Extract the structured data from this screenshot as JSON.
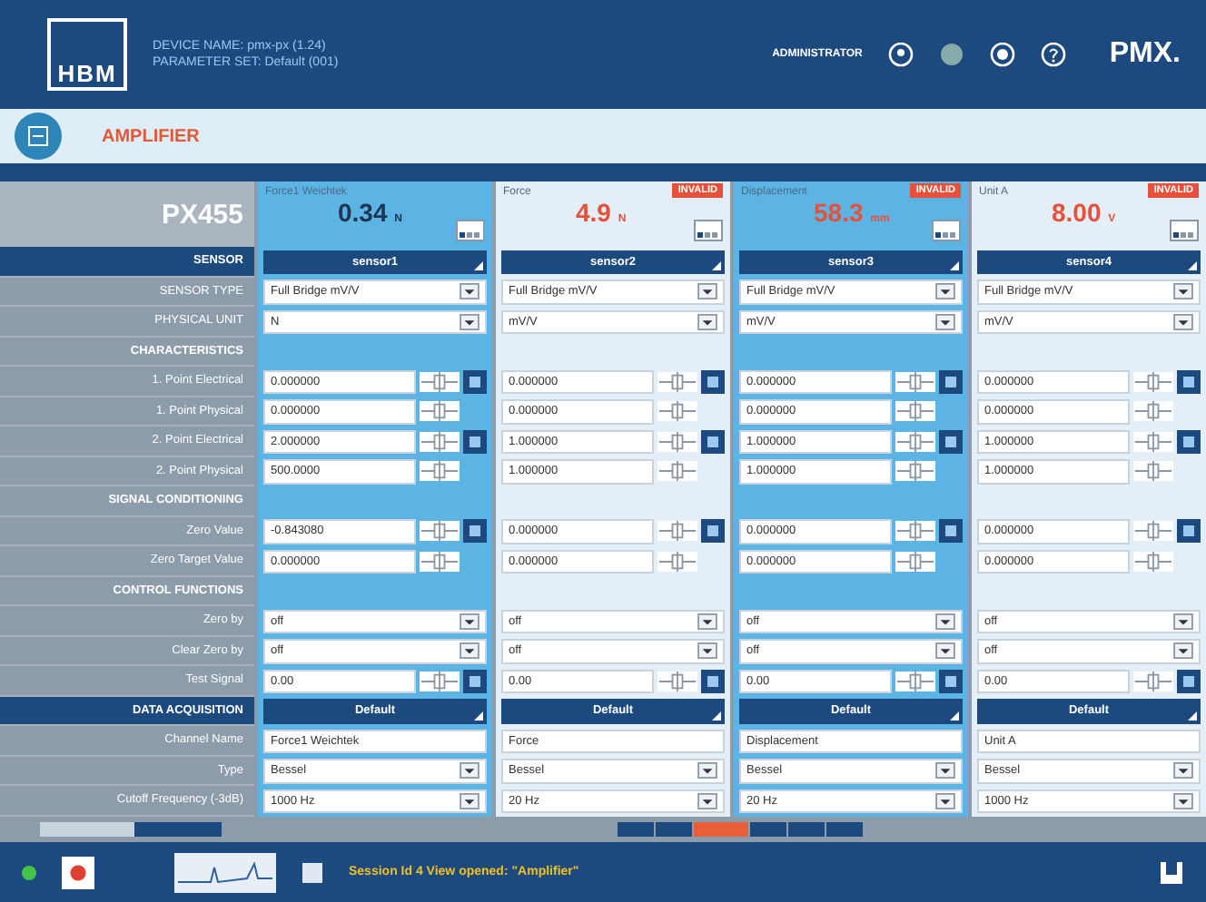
{
  "header": {
    "logo": "HBM",
    "device_name": "DEVICE NAME: pmx-px (1.24)",
    "parameter_set": "PARAMETER SET: Default (001)",
    "user": "ADMINISTRATOR",
    "brand": "PMX."
  },
  "page": {
    "title": "AMPLIFIER"
  },
  "module": "PX455",
  "channels": [
    {
      "name": "Force1 Weichtek",
      "value": "0.34",
      "unit": "N",
      "selected": true
    },
    {
      "name": "Force",
      "value": "4.9",
      "unit": "N",
      "badge": "INVALID",
      "selected": false
    },
    {
      "name": "Displacement",
      "value": "58.3",
      "unit": "mm",
      "badge": "INVALID",
      "selected": true
    },
    {
      "name": "Unit A",
      "value": "8.00",
      "unit": "V",
      "badge": "INVALID",
      "selected": false
    }
  ],
  "rows": [
    {
      "label": "SENSOR",
      "kind": "section",
      "values": [
        "sensor1",
        "sensor2",
        "sensor3",
        "sensor4"
      ]
    },
    {
      "label": "SENSOR TYPE",
      "kind": "select",
      "values": [
        "Full Bridge mV/V",
        "Full Bridge mV/V",
        "Full Bridge mV/V",
        "Full Bridge mV/V"
      ]
    },
    {
      "label": "PHYSICAL UNIT",
      "kind": "select",
      "values": [
        "N",
        "mV/V",
        "mV/V",
        "mV/V"
      ]
    },
    {
      "label": "CHARACTERISTICS",
      "kind": "group"
    },
    {
      "label": "1. Point Electrical",
      "kind": "number",
      "button": true,
      "values": [
        "0.000000",
        "0.000000",
        "0.000000",
        "0.000000"
      ]
    },
    {
      "label": "1. Point Physical",
      "kind": "number",
      "button": false,
      "values": [
        "0.000000",
        "0.000000",
        "0.000000",
        "0.000000"
      ]
    },
    {
      "label": "2. Point Electrical",
      "kind": "number",
      "button": true,
      "values": [
        "2.000000",
        "1.000000",
        "1.000000",
        "1.000000"
      ]
    },
    {
      "label": "2. Point Physical",
      "kind": "number",
      "button": false,
      "values": [
        "500.0000",
        "1.000000",
        "1.000000",
        "1.000000"
      ]
    },
    {
      "label": "SIGNAL CONDITIONING",
      "kind": "group"
    },
    {
      "label": "Zero Value",
      "kind": "number",
      "button": true,
      "values": [
        "-0.843080",
        "0.000000",
        "0.000000",
        "0.000000"
      ]
    },
    {
      "label": "Zero Target Value",
      "kind": "number",
      "button": false,
      "values": [
        "0.000000",
        "0.000000",
        "0.000000",
        "0.000000"
      ]
    },
    {
      "label": "CONTROL FUNCTIONS",
      "kind": "group"
    },
    {
      "label": "Zero by",
      "kind": "select",
      "values": [
        "off",
        "off",
        "off",
        "off"
      ]
    },
    {
      "label": "Clear Zero by",
      "kind": "select",
      "values": [
        "off",
        "off",
        "off",
        "off"
      ]
    },
    {
      "label": "Test Signal",
      "kind": "number",
      "button": true,
      "values": [
        "0.00",
        "0.00",
        "0.00",
        "0.00"
      ]
    },
    {
      "label": "DATA ACQUISITION",
      "kind": "section",
      "values": [
        "Default",
        "Default",
        "Default",
        "Default"
      ]
    },
    {
      "label": "Channel Name",
      "kind": "text",
      "values": [
        "Force1 Weichtek",
        "Force",
        "Displacement",
        "Unit A"
      ]
    },
    {
      "label": "Type",
      "kind": "select",
      "values": [
        "Bessel",
        "Bessel",
        "Bessel",
        "Bessel"
      ]
    },
    {
      "label": "Cutoff Frequency (-3dB)",
      "kind": "select",
      "values": [
        "1000 Hz",
        "20 Hz",
        "20 Hz",
        "1000 Hz"
      ]
    }
  ],
  "pager": [
    {
      "selected": false
    },
    {
      "selected": false
    },
    {
      "selected": true
    },
    {
      "selected": false
    },
    {
      "selected": false
    },
    {
      "selected": false
    }
  ],
  "status_bar": {
    "message": "Session Id 4 View opened: \"Amplifier\""
  }
}
